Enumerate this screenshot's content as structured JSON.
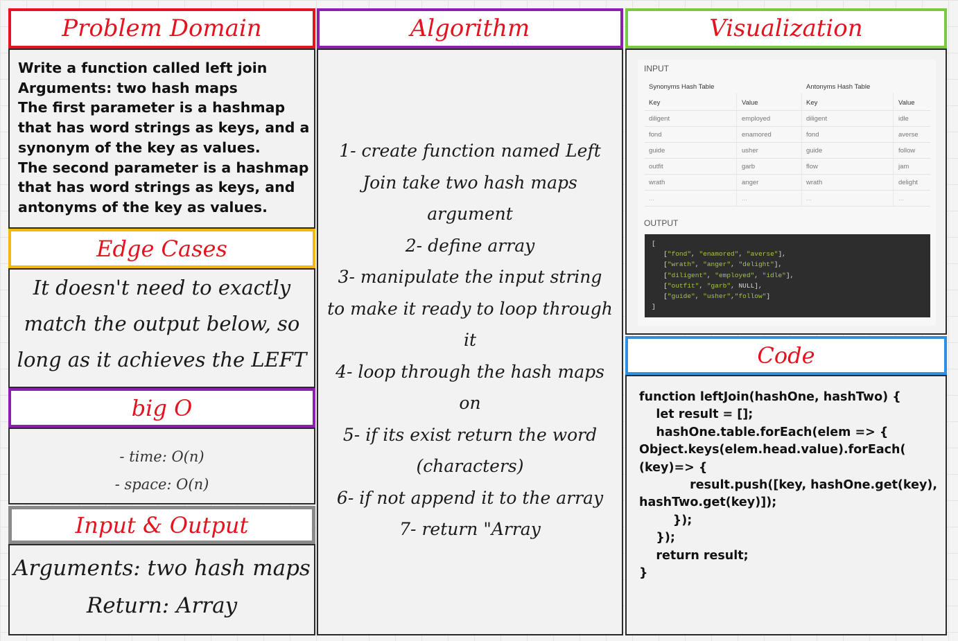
{
  "headers": {
    "problem_domain": "Problem Domain",
    "algorithm": "Algorithm",
    "visualization": "Visualization",
    "edge_cases": "Edge Cases",
    "big_o": "big O",
    "input_output": "Input & Output",
    "code": "Code"
  },
  "problem_domain": {
    "lines": [
      "Write a function called left join",
      "Arguments: two hash maps",
      "The first parameter is a hashmap",
      "that has word strings as keys, and a",
      "synonym of the key as values.",
      "The second parameter is a hashmap",
      "that has word strings as keys, and",
      "antonyms of the key as values."
    ]
  },
  "edge_cases": {
    "lines": [
      "It doesn't need to exactly",
      "match the output below, so",
      "long as it achieves the LEFT"
    ]
  },
  "big_o": {
    "lines": [
      "- time: O(n)",
      "- space: O(n)"
    ]
  },
  "input_output": {
    "lines": [
      "Arguments: two hash maps",
      "Return: Array"
    ]
  },
  "algorithm": {
    "lines": [
      "1- create function named Left",
      "Join take two hash maps",
      "argument",
      "2- define array",
      "3- manipulate the input string",
      "to make it ready to loop through",
      "it",
      "4- loop through the hash maps",
      "on",
      "5- if its exist return the word",
      "(characters)",
      "6- if not append it to the array",
      "7- return \"Array"
    ]
  },
  "visualization": {
    "input_label": "INPUT",
    "output_label": "OUTPUT",
    "synonyms_title": "Synonyms Hash Table",
    "antonyms_title": "Antonyms Hash Table",
    "col_key": "Key",
    "col_value": "Value",
    "synonyms_rows": [
      [
        "diligent",
        "employed"
      ],
      [
        "fond",
        "enamored"
      ],
      [
        "guide",
        "usher"
      ],
      [
        "outfit",
        "garb"
      ],
      [
        "wrath",
        "anger"
      ],
      [
        "...",
        "..."
      ]
    ],
    "antonyms_rows": [
      [
        "diligent",
        "idle"
      ],
      [
        "fond",
        "averse"
      ],
      [
        "guide",
        "follow"
      ],
      [
        "flow",
        "jam"
      ],
      [
        "wrath",
        "delight"
      ],
      [
        "...",
        "..."
      ]
    ],
    "output_open": "[",
    "output_rows": [
      [
        "fond",
        "enamored",
        "averse"
      ],
      [
        "wrath",
        "anger",
        "delight"
      ],
      [
        "diligent",
        "employed",
        "idle"
      ],
      [
        "outfit",
        "garb",
        "NULL"
      ],
      [
        "guide",
        "usher",
        "follow"
      ]
    ],
    "output_close": "]"
  },
  "code": {
    "lines": [
      "function leftJoin(hashOne, hashTwo) {",
      "    let result = [];",
      "",
      "    hashOne.table.forEach(elem => {",
      "",
      "Object.keys(elem.head.value).forEach(",
      "(key)=> {",
      "            result.push([key, hashOne.get(key),",
      "hashTwo.get(key)]);",
      "        });",
      "    });",
      "    return result;",
      "}"
    ]
  }
}
